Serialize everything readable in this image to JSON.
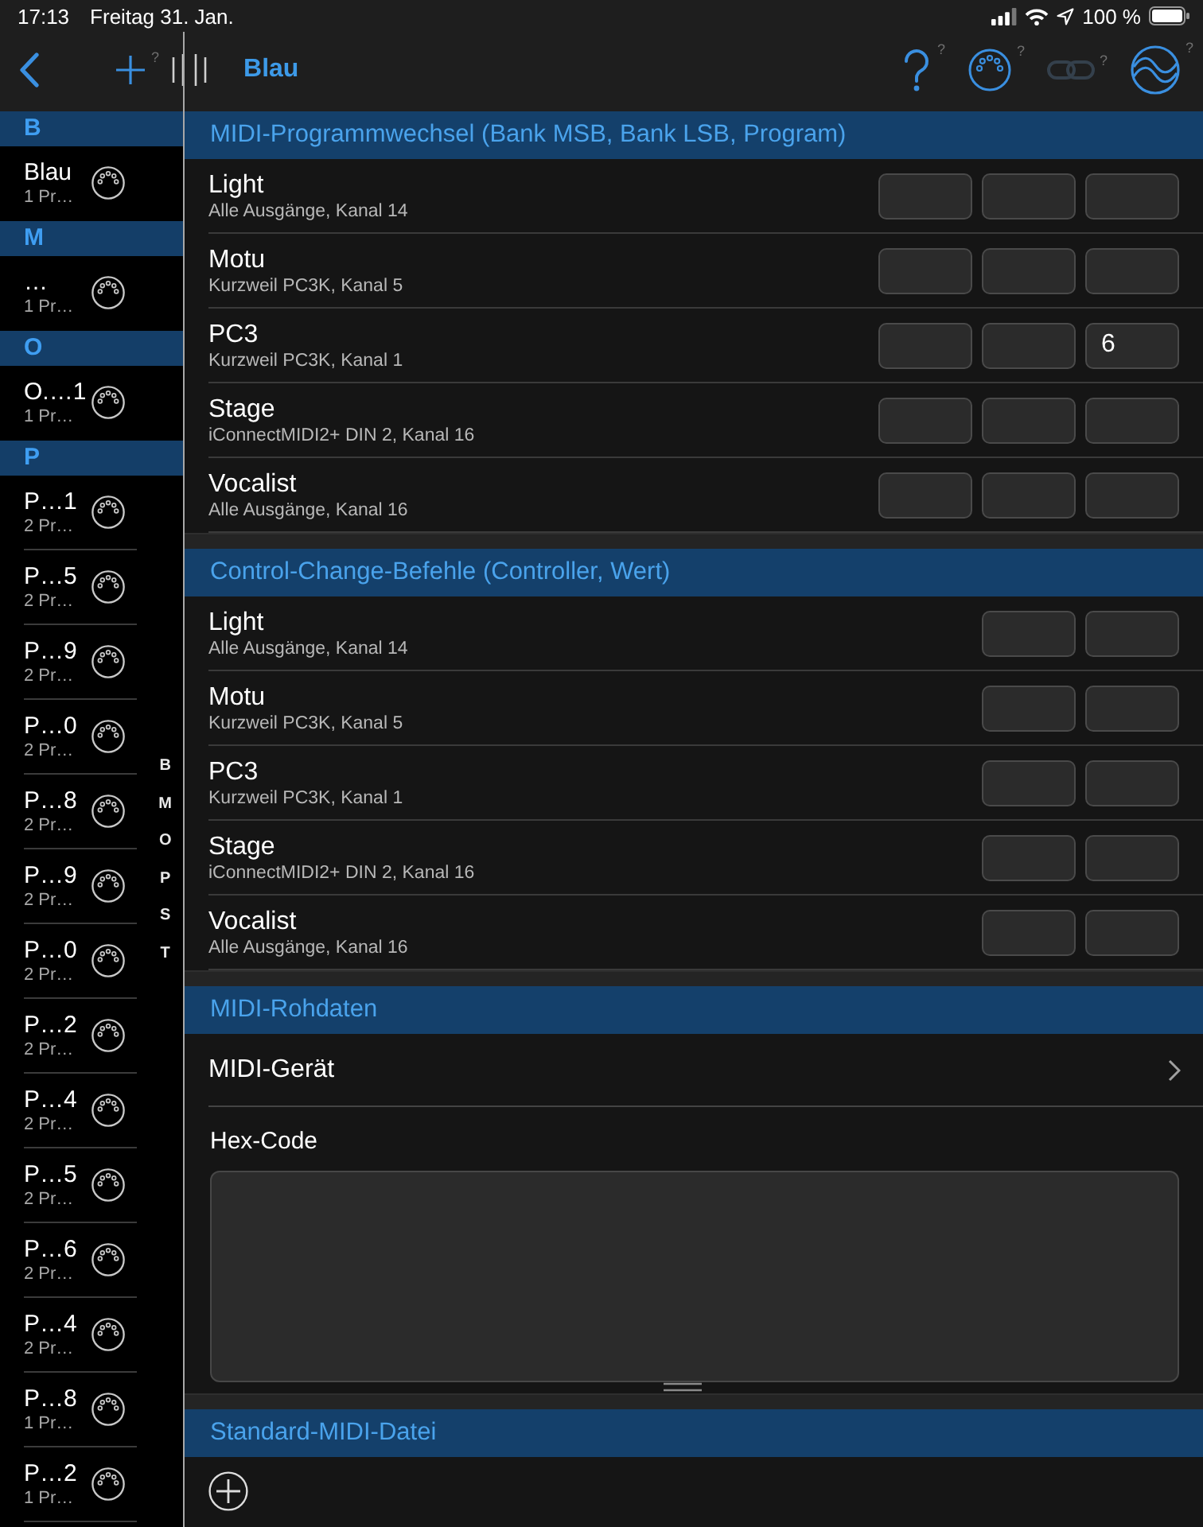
{
  "status_bar": {
    "time": "17:13",
    "date": "Freitag 31. Jan.",
    "battery": "100 %"
  },
  "nav": {
    "left_tools": [
      {
        "kind": "add",
        "hint": "?",
        "disabled": false
      }
    ],
    "title": "Blau",
    "right_tools": [
      {
        "kind": "help",
        "hint": "?",
        "disabled": false
      },
      {
        "kind": "midi",
        "hint": "?",
        "disabled": false
      },
      {
        "kind": "link",
        "hint": "?",
        "disabled": true
      },
      {
        "kind": "sync",
        "hint": "?",
        "disabled": false
      }
    ]
  },
  "sidebar": {
    "sections": [
      {
        "letter": "B",
        "items": [
          {
            "title": "Blau",
            "subtitle": "1 Pr…"
          }
        ]
      },
      {
        "letter": "M",
        "items": [
          {
            "title": "…",
            "subtitle": "1 Pr…"
          }
        ]
      },
      {
        "letter": "O",
        "items": [
          {
            "title": "O.…1",
            "subtitle": "1 Pr…"
          }
        ]
      },
      {
        "letter": "P",
        "items": [
          {
            "title": "P…1",
            "subtitle": "2 Pr…"
          },
          {
            "title": "P…5",
            "subtitle": "2 Pr…"
          },
          {
            "title": "P…9",
            "subtitle": "2 Pr…"
          },
          {
            "title": "P…0",
            "subtitle": "2 Pr…"
          },
          {
            "title": "P…8",
            "subtitle": "2 Pr…"
          },
          {
            "title": "P…9",
            "subtitle": "2 Pr…"
          },
          {
            "title": "P…0",
            "subtitle": "2 Pr…"
          },
          {
            "title": "P…2",
            "subtitle": "2 Pr…"
          },
          {
            "title": "P…4",
            "subtitle": "2 Pr…"
          },
          {
            "title": "P…5",
            "subtitle": "2 Pr…"
          },
          {
            "title": "P…6",
            "subtitle": "2 Pr…"
          },
          {
            "title": "P…4",
            "subtitle": "2 Pr…"
          },
          {
            "title": "P…8",
            "subtitle": "1 Pr…"
          },
          {
            "title": "P…2",
            "subtitle": "1 Pr…"
          }
        ]
      }
    ],
    "index": [
      "B",
      "M",
      "O",
      "P",
      "S",
      "T"
    ]
  },
  "sections": [
    {
      "kind": "program_change",
      "title": "MIDI-Programmwechsel (Bank MSB, Bank LSB, Program)",
      "rows": [
        {
          "name": "Light",
          "detail": "Alle Ausgänge, Kanal 14"
        },
        {
          "name": "Motu",
          "detail": "Kurzweil PC3K, Kanal 5"
        },
        {
          "name": "PC3",
          "detail": "Kurzweil PC3K, Kanal 1",
          "values": {
            "program": "6"
          }
        },
        {
          "name": "Stage",
          "detail": "iConnectMIDI2+ DIN 2, Kanal 16"
        },
        {
          "name": "Vocalist",
          "detail": "Alle Ausgänge, Kanal 16"
        }
      ]
    },
    {
      "kind": "control_change",
      "title": "Control-Change-Befehle (Controller, Wert)",
      "rows": [
        {
          "name": "Light",
          "detail": "Alle Ausgänge, Kanal 14"
        },
        {
          "name": "Motu",
          "detail": "Kurzweil PC3K, Kanal 5"
        },
        {
          "name": "PC3",
          "detail": "Kurzweil PC3K, Kanal 1"
        },
        {
          "name": "Stage",
          "detail": "iConnectMIDI2+ DIN 2, Kanal 16"
        },
        {
          "name": "Vocalist",
          "detail": "Alle Ausgänge, Kanal 16"
        }
      ]
    },
    {
      "kind": "raw_data",
      "title": "MIDI-Rohdaten",
      "rows": [
        {
          "kind": "link",
          "label": "MIDI-Gerät"
        },
        {
          "kind": "text_area",
          "label": "Hex-Code"
        }
      ]
    },
    {
      "kind": "files",
      "title": "Standard-MIDI-Datei",
      "rows": [
        {
          "kind": "add"
        }
      ]
    }
  ]
}
